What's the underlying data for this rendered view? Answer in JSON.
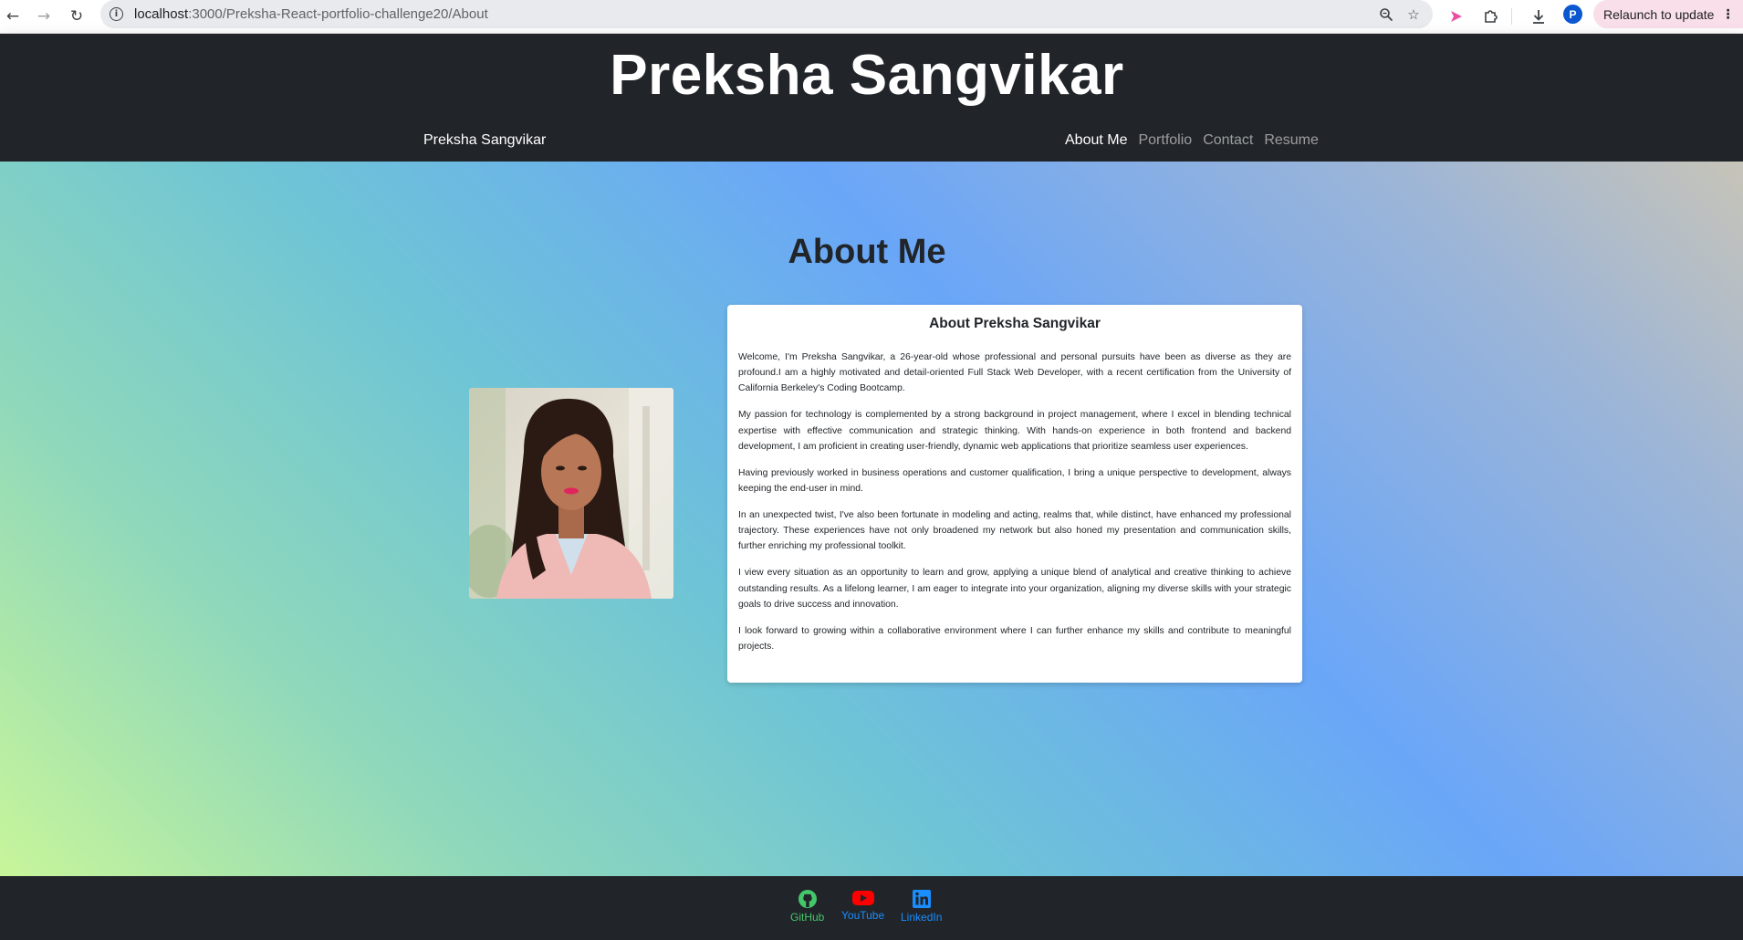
{
  "browser": {
    "url_host": "localhost",
    "url_path": ":3000/Preksha-React-portfolio-challenge20/About",
    "avatar_initial": "P",
    "relaunch_label": "Relaunch to update"
  },
  "header": {
    "site_title": "Preksha Sangvikar",
    "brand": "Preksha Sangvikar",
    "nav": [
      {
        "label": "About Me",
        "active": true
      },
      {
        "label": "Portfolio",
        "active": false
      },
      {
        "label": "Contact",
        "active": false
      },
      {
        "label": "Resume",
        "active": false
      }
    ]
  },
  "main": {
    "heading": "About Me",
    "card_title": "About Preksha Sangvikar",
    "paragraphs": [
      "Welcome, I'm Preksha Sangvikar, a 26-year-old whose professional and personal pursuits have been as diverse as they are profound.I am a highly motivated and detail-oriented Full Stack Web Developer, with a recent certification from the University of California Berkeley's Coding Bootcamp.",
      "My passion for technology is complemented by a strong background in project management, where I excel in blending technical expertise with effective communication and strategic thinking. With hands-on experience in both frontend and backend development, I am proficient in creating user-friendly, dynamic web applications that prioritize seamless user experiences.",
      "Having previously worked in business operations and customer qualification, I bring a unique perspective to development, always keeping the end-user in mind.",
      "In an unexpected twist, I've also been fortunate in modeling and acting, realms that, while distinct, have enhanced my professional trajectory. These experiences have not only broadened my network but also honed my presentation and communication skills, further enriching my professional toolkit.",
      "I view every situation as an opportunity to learn and grow, applying a unique blend of analytical and creative thinking to achieve outstanding results. As a lifelong learner, I am eager to integrate into your organization, aligning my diverse skills with your strategic goals to drive success and innovation.",
      "I look forward to growing within a collaborative environment where I can further enhance my skills and contribute to meaningful projects."
    ]
  },
  "footer": {
    "links": [
      {
        "label": "GitHub",
        "icon": "github-icon",
        "color": "#44c76a"
      },
      {
        "label": "YouTube",
        "icon": "youtube-icon",
        "color": "#ff0000"
      },
      {
        "label": "LinkedIn",
        "icon": "linkedin-icon",
        "color": "#1a8dff"
      }
    ]
  },
  "colors": {
    "header_bg": "#212529",
    "gradient_blue": "#6aa6f8",
    "gradient_green": "#c7f59a"
  }
}
